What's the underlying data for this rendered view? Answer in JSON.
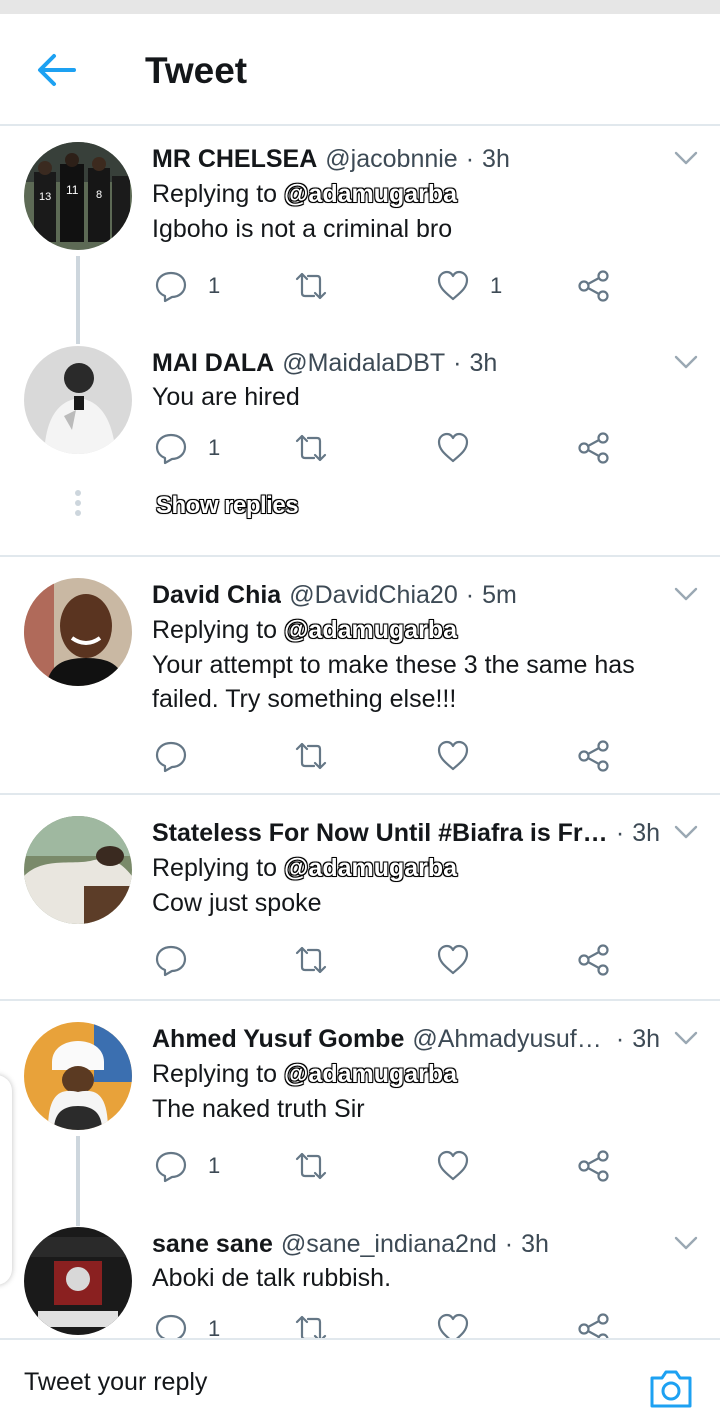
{
  "header": {
    "title": "Tweet"
  },
  "icons": {
    "back": "arrow-left-icon",
    "caret": "chevron-down-icon",
    "reply": "reply-bubble-icon",
    "retweet": "retweet-icon",
    "like": "heart-icon",
    "share": "share-icon",
    "camera": "camera-icon"
  },
  "colors": {
    "accent": "#1da1f2",
    "icon_gray": "#657786",
    "thread_line": "#cdd6dd",
    "divider": "#e1e8ed"
  },
  "tweets": [
    {
      "name": "MR CHELSEA",
      "handle": "@jacobnnie",
      "sep": "·",
      "time": "3h",
      "replying_prefix": "Replying to",
      "replying_to": "@adamugarba",
      "text": "Igboho is not a criminal bro",
      "reply_count": "1",
      "retweet_count": "",
      "like_count": "1"
    },
    {
      "name": "MAI DALA",
      "handle": "@MaidalaDBT",
      "sep": "·",
      "time": "3h",
      "text": "You are hired",
      "reply_count": "1",
      "retweet_count": "",
      "like_count": "",
      "show_replies": "Show replies"
    },
    {
      "name": "David Chia",
      "handle": "@DavidChia20",
      "sep": "·",
      "time": "5m",
      "replying_prefix": "Replying to",
      "replying_to": "@adamugarba",
      "text_line1": "Your attempt to make these 3 the same has",
      "text_line2": "failed. Try something else!!!",
      "reply_count": "",
      "retweet_count": "",
      "like_count": ""
    },
    {
      "name": "Stateless For Now Until #Biafra is Free …",
      "handle": "",
      "sep": "·",
      "time": "3h",
      "replying_prefix": "Replying to",
      "replying_to": "@adamugarba",
      "text": "Cow just spoke",
      "reply_count": "",
      "retweet_count": "",
      "like_count": ""
    },
    {
      "name": "Ahmed Yusuf Gombe",
      "handle": "@Ahmadyusufg…",
      "sep": "·",
      "time": "3h",
      "replying_prefix": "Replying to",
      "replying_to": "@adamugarba",
      "text": "The naked truth Sir",
      "reply_count": "1",
      "retweet_count": "",
      "like_count": ""
    },
    {
      "name": "sane sane",
      "handle": "@sane_indiana2nd",
      "sep": "·",
      "time": "3h",
      "text": "Aboki de talk rubbish.",
      "reply_count": "1",
      "retweet_count": "",
      "like_count": ""
    }
  ],
  "compose": {
    "placeholder": "Tweet your reply"
  }
}
